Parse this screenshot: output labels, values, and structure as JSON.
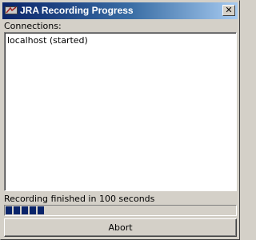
{
  "window": {
    "title": "JRA Recording Progress",
    "close_label": "✕"
  },
  "connections": {
    "label": "Connections:",
    "items": [
      "localhost (started)"
    ]
  },
  "status": {
    "text": "Recording finished in 100 seconds",
    "progress_fraction": 0.17
  },
  "buttons": {
    "abort_label": "Abort"
  },
  "colors": {
    "title_gradient_start": "#0a246a",
    "title_gradient_end": "#a6caf0",
    "progress_fill": "#0a246a",
    "face": "#d4d0c8"
  },
  "icons": {
    "app": "jra-app-icon",
    "close": "close-icon"
  }
}
